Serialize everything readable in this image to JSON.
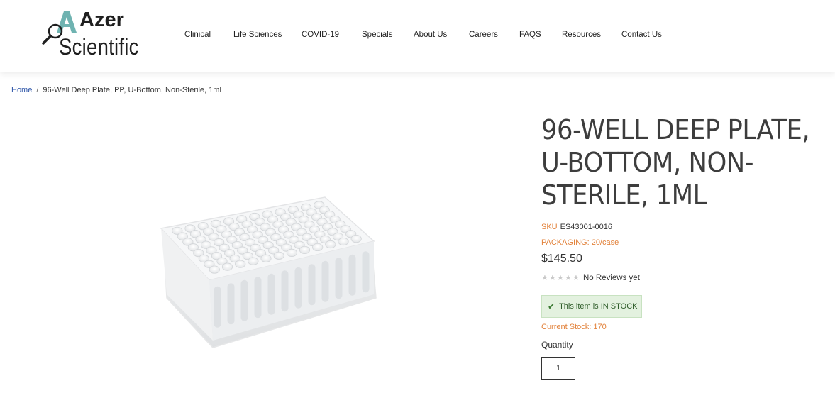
{
  "brand": {
    "line1": "Azer",
    "line2": "Scientific",
    "accent": "#5fa7a6"
  },
  "nav": [
    {
      "label": "Clinical"
    },
    {
      "label": "Life Sciences"
    },
    {
      "label": "COVID-19"
    },
    {
      "label": "Specials"
    },
    {
      "label": "About Us"
    },
    {
      "label": "Careers"
    },
    {
      "label": "FAQS"
    },
    {
      "label": "Resources"
    },
    {
      "label": "Contact Us"
    }
  ],
  "breadcrumb": {
    "home": "Home",
    "separator": "/",
    "current": "96-Well Deep Plate, PP, U-Bottom, Non-Sterile, 1mL"
  },
  "product": {
    "title": "96-Well Deep Plate, U-Bottom, Non-Sterile, 1mL",
    "sku_label": "SKU",
    "sku": "ES43001-0016",
    "packaging": "PACKAGING: 20/case",
    "price": "$145.50",
    "rating_stars": 0,
    "reviews": "No Reviews yet",
    "stock_icon": "check-icon",
    "stock_status": "This item is IN STOCK",
    "current_stock": "Current Stock: 170",
    "quantity_label": "Quantity",
    "quantity_value": "1"
  },
  "colors": {
    "orange_label": "#e2823b",
    "link_blue": "#2d55a8",
    "stock_bg": "#e3f1df"
  }
}
